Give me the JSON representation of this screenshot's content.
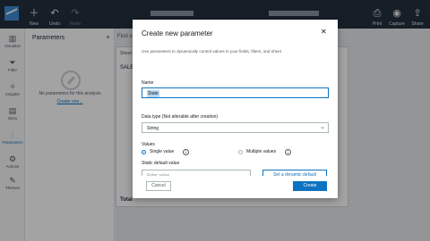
{
  "topbar": {
    "new_label": "New",
    "undo_label": "Undo",
    "redo_label": "Redo",
    "share_label": "Share",
    "capture_label": "Capture",
    "print_label": "Print",
    "icons": {
      "new": "plus-icon",
      "undo": "undo-icon",
      "redo": "redo-icon",
      "print": "printer-icon",
      "capture": "camera-icon",
      "share": "share-icon"
    }
  },
  "rail": {
    "items": [
      {
        "label": "Visualize",
        "icon": "chart-icon"
      },
      {
        "label": "Filter",
        "icon": "filter-icon"
      },
      {
        "label": "Insights",
        "icon": "insights-icon"
      },
      {
        "label": "Story",
        "icon": "story-icon"
      },
      {
        "label": "Parameters",
        "icon": "parameters-icon"
      },
      {
        "label": "Actions",
        "icon": "actions-icon"
      },
      {
        "label": "Themes",
        "icon": "brush-icon"
      }
    ]
  },
  "panel": {
    "title": "Parameters",
    "empty_text": "No parameters for this analysis",
    "link": "Create one..."
  },
  "sheet": {
    "tab": "Find v...",
    "sub": "Sheet",
    "title": "SALE",
    "total_label": "Total"
  },
  "modal": {
    "title": "Create new parameter",
    "description": "Use parameters to dynamically control values in your fields, filters, and sheet",
    "name_label": "Name",
    "name_value": "State",
    "data_type_label": "Data type (Not alterable after creation)",
    "data_type_value": "String",
    "values_label": "Values",
    "single_value_label": "Single value",
    "multiple_values_label": "Multiple values",
    "static_default_label": "Static default value",
    "static_default_placeholder": "Enter value",
    "dynamic_default_button": "Set a dynamic default",
    "cancel_button": "Cancel",
    "create_button": "Create"
  },
  "colors": {
    "accent": "#0d73c0",
    "topbar": "#232f3e",
    "overlay": "rgba(0,0,0,0.36)"
  }
}
